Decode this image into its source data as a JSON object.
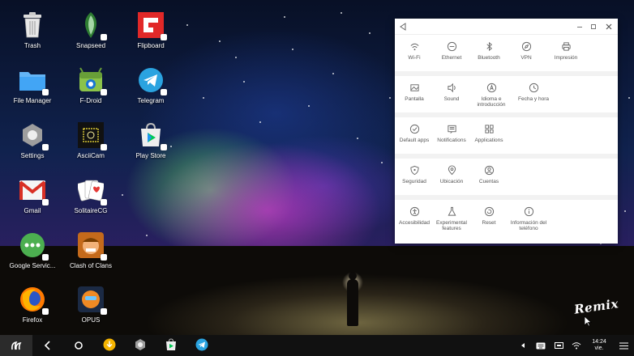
{
  "desktop": {
    "icons": [
      {
        "label": "Trash"
      },
      {
        "label": "Snapseed"
      },
      {
        "label": "Flipboard"
      },
      {
        "label": "File Manager"
      },
      {
        "label": "F-Droid"
      },
      {
        "label": "Telegram"
      },
      {
        "label": "Settings"
      },
      {
        "label": "AsciiCam"
      },
      {
        "label": "Play Store"
      },
      {
        "label": "Gmail"
      },
      {
        "label": "SolitaireCG"
      },
      {
        "label": "Google Servic..."
      },
      {
        "label": "Clash of Clans"
      },
      {
        "label": "Firefox"
      },
      {
        "label": "OPUS"
      }
    ],
    "logo_text": "Remix"
  },
  "settings": {
    "rows": [
      [
        {
          "label": "Wi-Fi",
          "icon": "wifi-icon"
        },
        {
          "label": "Ethernet",
          "icon": "ethernet-icon"
        },
        {
          "label": "Bluetooth",
          "icon": "bluetooth-icon"
        },
        {
          "label": "VPN",
          "icon": "vpn-icon"
        },
        {
          "label": "Impresión",
          "icon": "printer-icon"
        }
      ],
      [
        {
          "label": "Pantalla",
          "icon": "display-icon"
        },
        {
          "label": "Sound",
          "icon": "sound-icon"
        },
        {
          "label": "Idioma e introducción",
          "icon": "language-icon"
        },
        {
          "label": "Fecha y hora",
          "icon": "clock-icon"
        }
      ],
      [
        {
          "label": "Default apps",
          "icon": "check-circle-icon"
        },
        {
          "label": "Notifications",
          "icon": "notifications-icon"
        },
        {
          "label": "Applications",
          "icon": "apps-grid-icon"
        }
      ],
      [
        {
          "label": "Seguridad",
          "icon": "shield-icon"
        },
        {
          "label": "Ubicación",
          "icon": "location-icon"
        },
        {
          "label": "Cuentas",
          "icon": "account-icon"
        }
      ],
      [
        {
          "label": "Accesibilidad",
          "icon": "accessibility-icon"
        },
        {
          "label": "Experimental features",
          "icon": "flask-icon"
        },
        {
          "label": "Reset",
          "icon": "reset-icon"
        },
        {
          "label": "Información del teléfono",
          "icon": "info-icon"
        }
      ]
    ]
  },
  "taskbar": {
    "clock_time": "14:24",
    "clock_day": "vie."
  },
  "colors": {
    "taskbar_bg": "#111111",
    "window_bg": "#ffffff",
    "settings_icon_stroke": "#555555"
  }
}
